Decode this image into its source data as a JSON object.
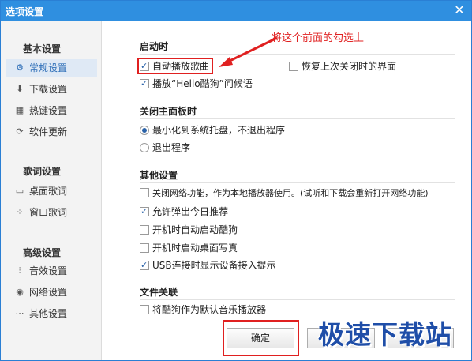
{
  "window": {
    "title": "选项设置",
    "close_glyph": "✕"
  },
  "sidebar": {
    "groups": [
      {
        "title": "基本设置",
        "items": [
          {
            "label": "常规设置",
            "icon": "gear-icon",
            "glyph": "⚙",
            "active": true
          },
          {
            "label": "下载设置",
            "icon": "download-icon",
            "glyph": "⬇",
            "active": false
          },
          {
            "label": "热键设置",
            "icon": "keyboard-icon",
            "glyph": "▦",
            "active": false
          },
          {
            "label": "软件更新",
            "icon": "update-icon",
            "glyph": "⟳",
            "active": false
          }
        ]
      },
      {
        "title": "歌词设置",
        "items": [
          {
            "label": "桌面歌词",
            "icon": "desktop-lyrics-icon",
            "glyph": "▭",
            "active": false
          },
          {
            "label": "窗口歌词",
            "icon": "window-lyrics-icon",
            "glyph": "⁘",
            "active": false
          }
        ]
      },
      {
        "title": "高级设置",
        "items": [
          {
            "label": "音效设置",
            "icon": "equalizer-icon",
            "glyph": "⫶",
            "active": false
          },
          {
            "label": "网络设置",
            "icon": "network-icon",
            "glyph": "◉",
            "active": false
          },
          {
            "label": "其他设置",
            "icon": "more-icon",
            "glyph": "⋯",
            "active": false
          }
        ]
      }
    ]
  },
  "content": {
    "startup": {
      "title": "启动时",
      "auto_play": {
        "label": "自动播放歌曲",
        "checked": true
      },
      "restore_ui": {
        "label": "恢复上次关闭时的界面",
        "checked": false
      },
      "greeting": {
        "label": "播放“Hello酷狗”问候语",
        "checked": true
      }
    },
    "close_panel": {
      "title": "关闭主面板时",
      "minimize": {
        "label": "最小化到系统托盘，不退出程序",
        "selected": true
      },
      "exit": {
        "label": "退出程序",
        "selected": false
      }
    },
    "other": {
      "title": "其他设置",
      "disable_network": {
        "label": "关闭网络功能，作为本地播放器使用。(试听和下载会重新打开网络功能)",
        "checked": false
      },
      "daily_recommend": {
        "label": "允许弹出今日推荐",
        "checked": true
      },
      "auto_start": {
        "label": "开机时自动启动酷狗",
        "checked": false
      },
      "desktop_photo": {
        "label": "开机时启动桌面写真",
        "checked": false
      },
      "usb_prompt": {
        "label": "USB连接时显示设备接入提示",
        "checked": true
      }
    },
    "file_assoc": {
      "title": "文件关联",
      "default_player": {
        "label": "将酷狗作为默认音乐播放器",
        "checked": false
      }
    }
  },
  "annotation": {
    "text": "将这个前面的勾选上"
  },
  "buttons": {
    "ok": "确定",
    "cancel": "",
    "apply": ""
  },
  "watermark": {
    "text": "极速下载站"
  },
  "colors": {
    "titlebar": "#2f8fe0",
    "annotation": "#e02020",
    "active_item": "#dfe9f5"
  }
}
